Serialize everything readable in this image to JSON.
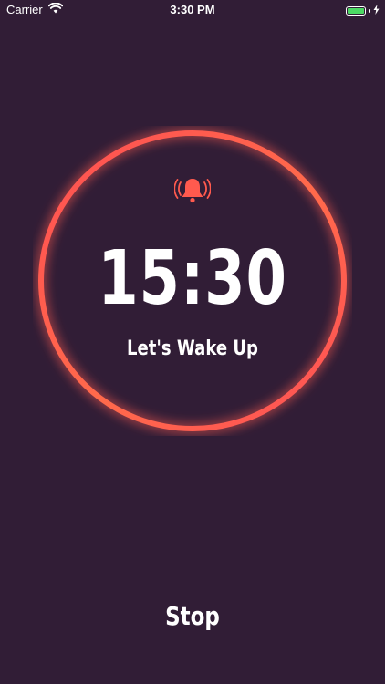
{
  "status_bar": {
    "carrier": "Carrier",
    "time": "3:30 PM",
    "wifi_icon": "wifi-icon",
    "battery_icon": "battery-icon",
    "charging_icon": "bolt-icon",
    "battery_level": 1.0,
    "battery_color": "#4cd964"
  },
  "alarm": {
    "icon": "ringing-bell-icon",
    "time": "15:30",
    "label": "Let's Wake Up",
    "accent_color": "#ff5a4e"
  },
  "actions": {
    "stop_label": "Stop"
  }
}
